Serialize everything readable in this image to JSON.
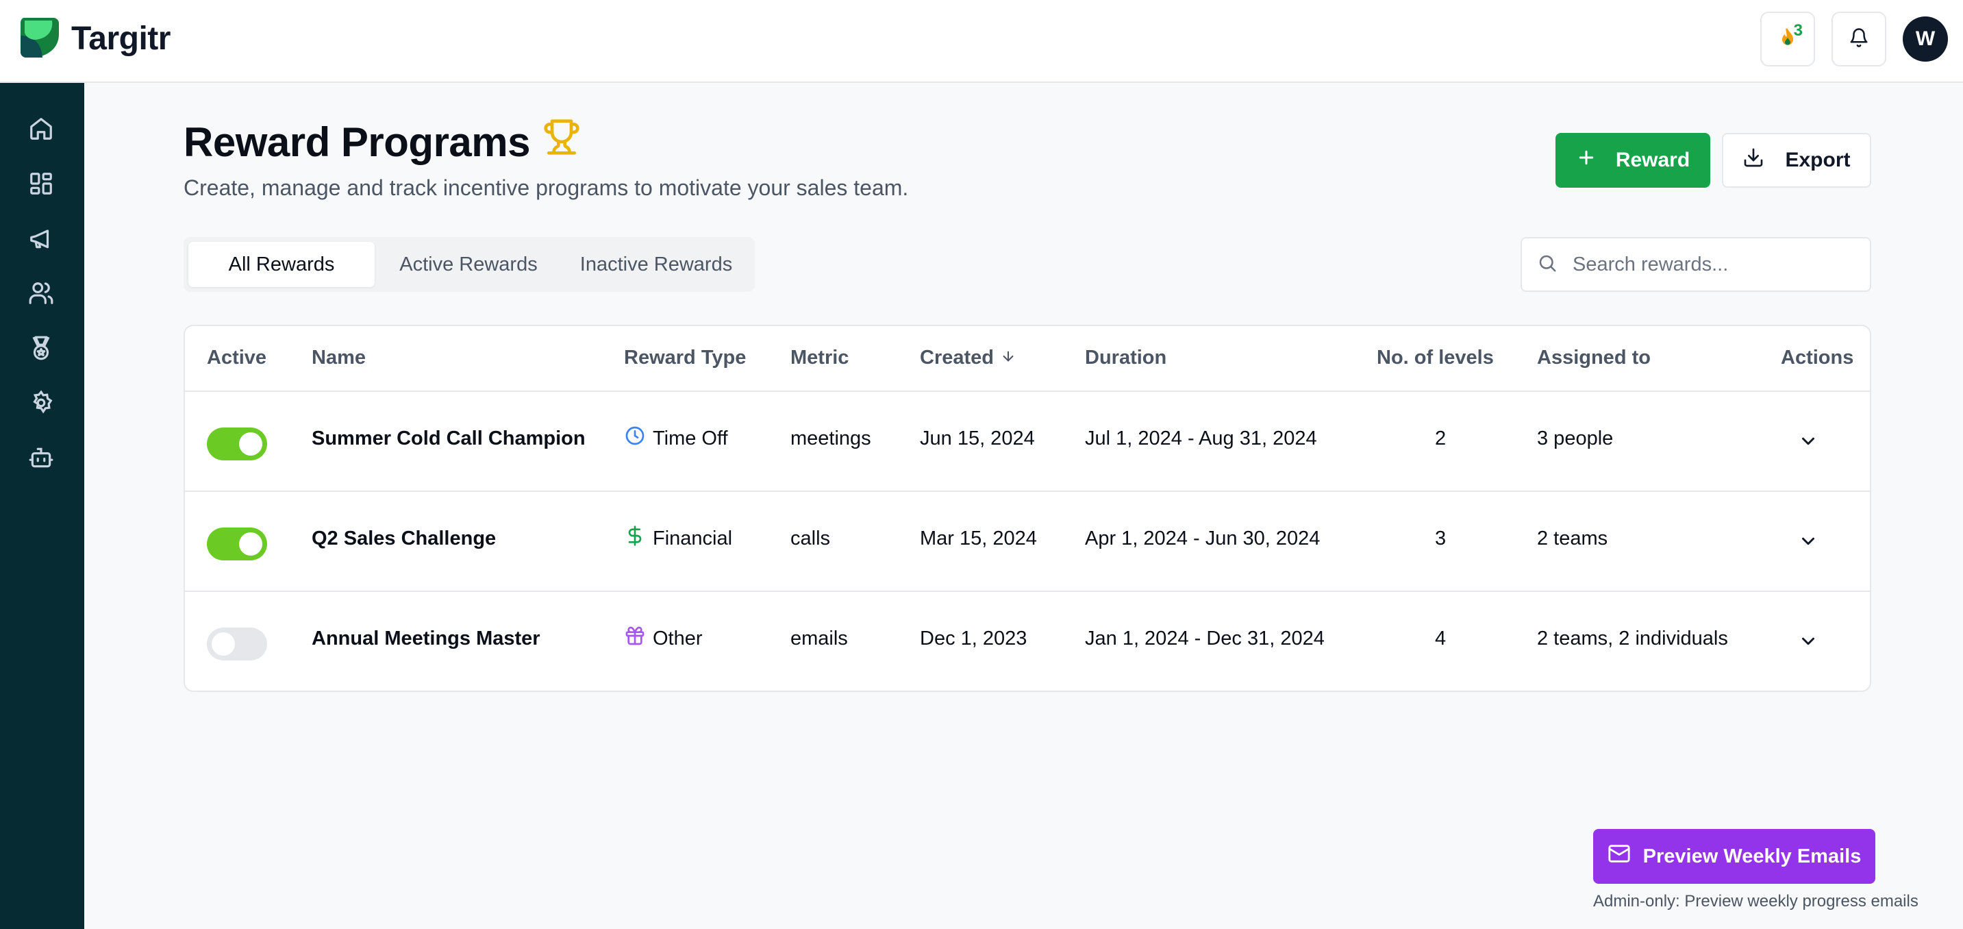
{
  "brand": {
    "name": "Targitr"
  },
  "topbar": {
    "streak_count": "3",
    "avatar_initial": "W"
  },
  "sidebar": {
    "items": [
      {
        "icon": "home-icon"
      },
      {
        "icon": "dashboard-icon"
      },
      {
        "icon": "megaphone-icon"
      },
      {
        "icon": "users-icon"
      },
      {
        "icon": "medal-icon"
      },
      {
        "icon": "gear-icon"
      },
      {
        "icon": "bot-icon"
      }
    ]
  },
  "header": {
    "title": "Reward Programs",
    "subtitle": "Create, manage and track incentive programs to motivate your sales team.",
    "reward_button": "Reward",
    "export_button": "Export"
  },
  "tabs": [
    {
      "label": "All Rewards",
      "active": true
    },
    {
      "label": "Active Rewards",
      "active": false
    },
    {
      "label": "Inactive Rewards",
      "active": false
    }
  ],
  "search": {
    "placeholder": "Search rewards..."
  },
  "table": {
    "columns": {
      "active": "Active",
      "name": "Name",
      "reward_type": "Reward Type",
      "metric": "Metric",
      "created": "Created",
      "duration": "Duration",
      "levels": "No. of levels",
      "assigned": "Assigned to",
      "actions": "Actions"
    },
    "rows": [
      {
        "active": true,
        "name": "Summer Cold Call Champion",
        "reward_type": "Time Off",
        "type_icon": "clock-icon",
        "metric": "meetings",
        "created": "Jun 15, 2024",
        "duration": "Jul 1, 2024 - Aug 31, 2024",
        "levels": "2",
        "assigned": "3 people"
      },
      {
        "active": true,
        "name": "Q2 Sales Challenge",
        "reward_type": "Financial",
        "type_icon": "dollar-icon",
        "metric": "calls",
        "created": "Mar 15, 2024",
        "duration": "Apr 1, 2024 - Jun 30, 2024",
        "levels": "3",
        "assigned": "2 teams"
      },
      {
        "active": false,
        "name": "Annual Meetings Master",
        "reward_type": "Other",
        "type_icon": "gift-icon",
        "metric": "emails",
        "created": "Dec 1, 2023",
        "duration": "Jan 1, 2024 - Dec 31, 2024",
        "levels": "4",
        "assigned": "2 teams, 2 individuals"
      }
    ]
  },
  "footer": {
    "preview_button": "Preview Weekly Emails",
    "admin_note": "Admin-only: Preview weekly progress emails"
  },
  "colors": {
    "sidebar": "#062b33",
    "primary": "#16a34a",
    "toggle_on": "#6bcb24",
    "preview": "#9333ea",
    "trophy": "#eab308"
  }
}
